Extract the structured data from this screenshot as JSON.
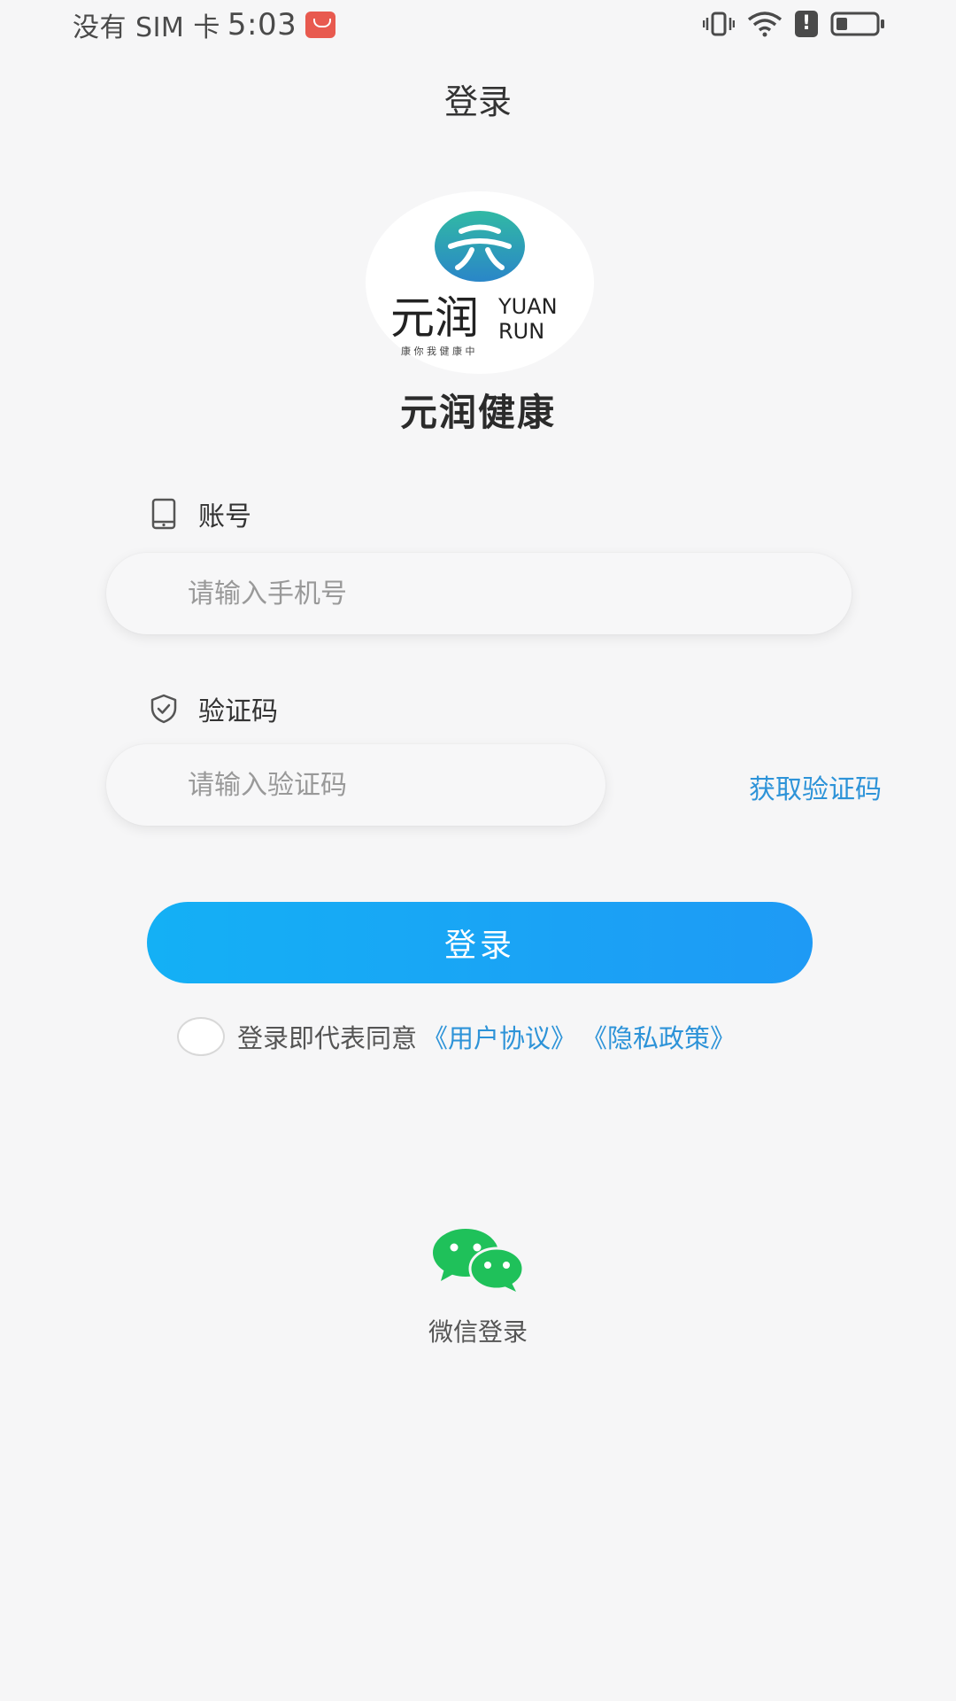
{
  "status_bar": {
    "carrier": "没有 SIM 卡",
    "time": "5:03"
  },
  "header": {
    "title": "登录"
  },
  "logo": {
    "chinese": "元润",
    "english_line1": "YUAN",
    "english_line2": "RUN",
    "slogan": "康 你 我   健 康 中"
  },
  "brand": {
    "name": "元润健康"
  },
  "form": {
    "account_label": "账号",
    "phone_placeholder": "请输入手机号",
    "code_label": "验证码",
    "code_placeholder": "请输入验证码",
    "get_code": "获取验证码",
    "login_button": "登录"
  },
  "agreement": {
    "text": "登录即代表同意",
    "user_agreement": "《用户协议》",
    "privacy_policy": "《隐私政策》"
  },
  "wechat": {
    "label": "微信登录",
    "icon": "wechat-icon"
  },
  "colors": {
    "accent": "#1ea6f5",
    "link": "#2d93d8",
    "wechat_green": "#1fc15a",
    "logo_teal": "#2bb0a4"
  }
}
